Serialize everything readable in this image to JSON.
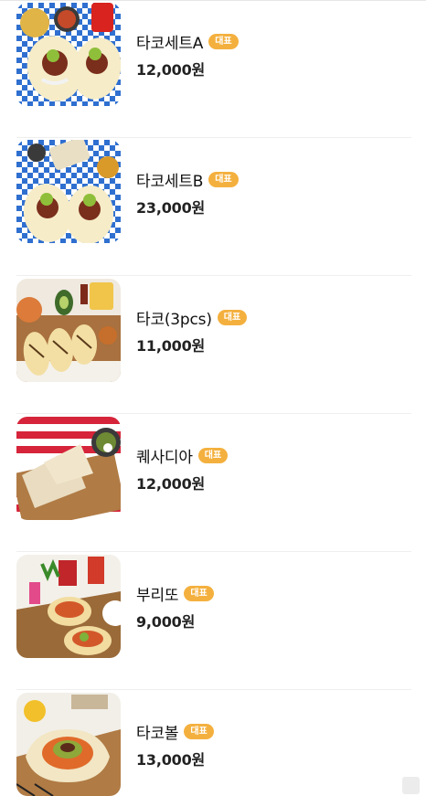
{
  "menu": {
    "items": [
      {
        "name": "타코세트A",
        "badge": "대표",
        "price": "12,000원",
        "image_icon": "taco-set-photo"
      },
      {
        "name": "타코세트B",
        "badge": "대표",
        "price": "23,000원",
        "image_icon": "taco-set-photo"
      },
      {
        "name": "타코(3pcs)",
        "badge": "대표",
        "price": "11,000원",
        "image_icon": "tacos-photo"
      },
      {
        "name": "퀘사디아",
        "badge": "대표",
        "price": "12,000원",
        "image_icon": "quesadilla-photo"
      },
      {
        "name": "부리또",
        "badge": "대표",
        "price": "9,000원",
        "image_icon": "burrito-photo"
      },
      {
        "name": "타코볼",
        "badge": "대표",
        "price": "13,000원",
        "image_icon": "taco-bowl-photo"
      }
    ]
  },
  "colors": {
    "badge": "#f4b03e",
    "divider": "#efefef"
  }
}
